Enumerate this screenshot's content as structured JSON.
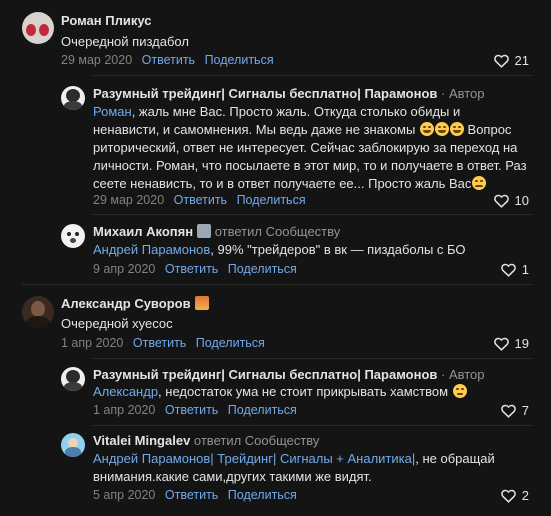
{
  "comments": [
    {
      "author": "Роман Пликус",
      "text": "Очередной пиздабол",
      "date": "29 мар 2020",
      "likes": "21"
    },
    {
      "author": "Разумный трейдинг| Сигналы бесплатно| Парамонов",
      "author_badge": " · Автор",
      "mention": "Роман",
      "text_1": ", жаль мне Вас. Просто жаль. Откуда столько обиды и",
      "text_2": "ненависти, и самомнения. Мы ведь даже не знакомы",
      "text_2b": " Вопрос",
      "text_3": "риторический, ответ не интересует. Сейчас заблокирую за переход на",
      "text_4": "личности. Роман, что посылаете в этот мир, то и получаете в ответ. Раз",
      "text_5": "сеете ненависть, то и в ответ получаете ее... Просто жаль Вас",
      "date": "29 мар 2020",
      "likes": "10"
    },
    {
      "author": "Михаил Акопян",
      "replied_prefix": " ответил ",
      "replied_to": "Сообществу",
      "mention": "Андрей Парамонов",
      "text": ", 99% \"трейдеров\" в вк — пиздаболы с БО",
      "date": "9 апр 2020",
      "likes": "1"
    },
    {
      "author": "Александр Суворов",
      "text": "Очередной хуесос",
      "date": "1 апр 2020",
      "likes": "19"
    },
    {
      "author": "Разумный трейдинг| Сигналы бесплатно| Парамонов",
      "author_badge": " · Автор",
      "mention": "Александр",
      "text": ", недостаток ума не стоит прикрывать хамством",
      "date": "1 апр 2020",
      "likes": "7"
    },
    {
      "author": "Vitalei Mingalev",
      "replied_prefix": " ответил ",
      "replied_to": "Сообществу",
      "mention": "Андрей Парамонов| Трейдинг| Сигналы + Аналитика|",
      "text_1": ", не обращай",
      "text_2": "внимания.какие сами,других такими же видят.",
      "date": "5 апр 2020",
      "likes": "2"
    }
  ],
  "actions": {
    "reply": "Ответить",
    "share": "Поделиться"
  }
}
